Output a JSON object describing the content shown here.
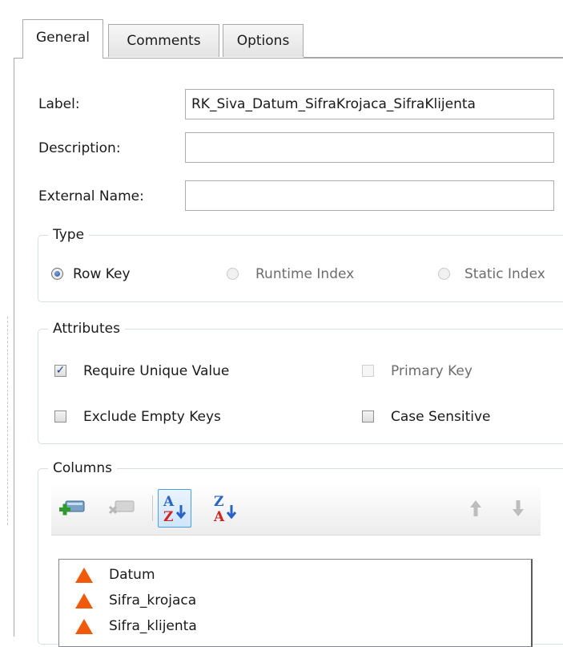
{
  "tabs": [
    {
      "label": "General",
      "active": true
    },
    {
      "label": "Comments",
      "active": false
    },
    {
      "label": "Options",
      "active": false
    }
  ],
  "fields": {
    "label": {
      "label": "Label:",
      "value": "RK_Siva_Datum_SifraKrojaca_SifraKlijenta"
    },
    "description": {
      "label": "Description:",
      "value": ""
    },
    "external_name": {
      "label": "External Name:",
      "value": ""
    }
  },
  "type_group": {
    "title": "Type",
    "options": [
      {
        "label": "Row Key",
        "selected": true,
        "enabled": true
      },
      {
        "label": "Runtime Index",
        "selected": false,
        "enabled": false
      },
      {
        "label": "Static Index",
        "selected": false,
        "enabled": false
      }
    ]
  },
  "attributes_group": {
    "title": "Attributes",
    "checkboxes": [
      {
        "label": "Require Unique Value",
        "checked": true,
        "enabled": true
      },
      {
        "label": "Primary Key",
        "checked": false,
        "enabled": false
      },
      {
        "label": "Exclude Empty Keys",
        "checked": false,
        "enabled": true
      },
      {
        "label": "Case Sensitive",
        "checked": false,
        "enabled": true
      }
    ]
  },
  "columns_group": {
    "title": "Columns",
    "toolbar_icons": [
      "add-column-icon",
      "remove-column-icon",
      "sort-ascending-icon",
      "sort-descending-icon",
      "move-up-icon",
      "move-down-icon"
    ],
    "sort_ascending_pressed": true,
    "items": [
      "Datum",
      "Sifra_krojaca",
      "Sifra_klijenta"
    ],
    "item_icon": "triangle-warning-icon"
  },
  "colors": {
    "accent": "#1f4f9a",
    "column_icon": "#f05a0a",
    "pressed_border": "#4d9ee8"
  }
}
